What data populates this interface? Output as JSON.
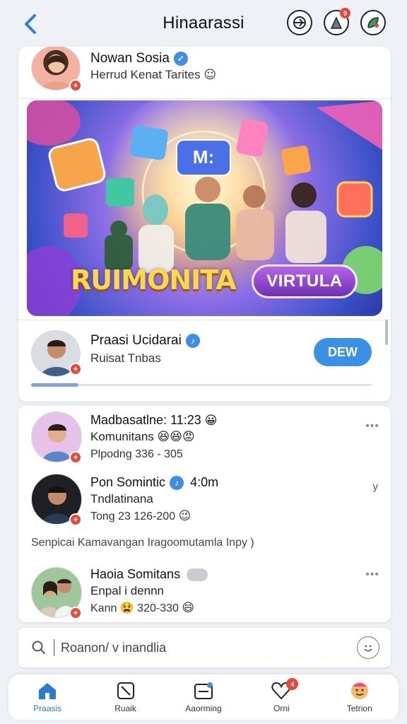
{
  "header": {
    "title": "Hinaarassi",
    "badge_count": "9"
  },
  "profile": {
    "name": "Nowan Sosia",
    "subtitle": "Herrud Kenat Tarites",
    "subtitle_emoji": "☺"
  },
  "banner": {
    "title": "RUIMONITA",
    "button_label": "VIRTULA",
    "tile_label": "M:"
  },
  "creator": {
    "name": "Praasi Ucidarai",
    "subtitle": "Ruisat Tnbas",
    "button_label": "DEW",
    "progress": 0.14
  },
  "feed": {
    "items": [
      {
        "name": "Madbasatlne: 11:23",
        "line2": "Komunitans",
        "meta": "Plpodng 336 - 305",
        "emoji1": "😀",
        "emoji2": "😆😆😡"
      },
      {
        "name": "Pon Somintic",
        "time": "4:0m",
        "line2": "Tndlatinana",
        "meta": "Tong 23 126-200",
        "emoji2": "😉"
      },
      {
        "name": "Haoia Somitans",
        "line2": "Enpal i dennn",
        "meta": "Kann 😫 320-330",
        "emoji2": "😄"
      }
    ],
    "notice": "Senpicai  Kamavangan  Iragoomutamla  Inpy  )"
  },
  "search": {
    "placeholder": "Roanon/ v inandlia"
  },
  "bottom_nav": {
    "items": [
      {
        "label": "Praasis"
      },
      {
        "label": "Ruaik"
      },
      {
        "label": "Aaorming"
      },
      {
        "label": "Orni"
      },
      {
        "label": "Tetrion"
      }
    ],
    "badge_count": "4"
  },
  "colors": {
    "accent": "#3a90e2",
    "badge": "#e8463a",
    "verified": "#3e8ee6"
  }
}
